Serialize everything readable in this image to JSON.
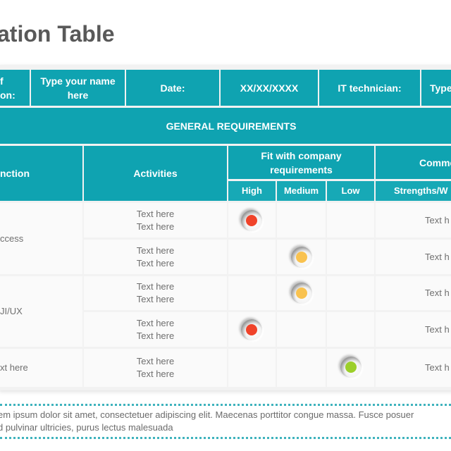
{
  "title": "ation Table",
  "info_row": {
    "name_label": "f\non:",
    "name_label_line1": "f",
    "name_label_line2": "on:",
    "name_value": "Type your name here",
    "date_label": "Date:",
    "date_value": "XX/XX/XXXX",
    "tech_label": "IT technician:",
    "tech_value": "Type"
  },
  "section_header": "GENERAL REQUIREMENTS",
  "columns": {
    "function": "nction",
    "activities": "Activities",
    "fit": "Fit with company requirements",
    "fit_high": "High",
    "fit_medium": "Medium",
    "fit_low": "Low",
    "comments": "Comme",
    "comments_sub": "Strengths/W"
  },
  "rows": [
    {
      "function": "ccess",
      "activities": [
        "Text here",
        "Text here"
      ],
      "fit": "High",
      "comment": "Text h"
    },
    {
      "function": "",
      "activities": [
        "Text here",
        "Text here"
      ],
      "fit": "Medium",
      "comment": "Text h"
    },
    {
      "function": "JI/UX",
      "activities": [
        "Text here",
        "Text here"
      ],
      "fit": "Medium",
      "comment": "Text h"
    },
    {
      "function": "",
      "activities": [
        "Text here",
        "Text here"
      ],
      "fit": "High",
      "comment": "Text h"
    },
    {
      "function": "xt here",
      "activities": [
        "Text here",
        "Text here"
      ],
      "fit": "Low",
      "comment": "Text h"
    }
  ],
  "function_groups": [
    "ccess",
    "JI/UX",
    "xt here"
  ],
  "fit_colors": {
    "High": "#f0432a",
    "Medium": "#f9c24f",
    "Low": "#9ccf2a"
  },
  "footer": {
    "line1": "em ipsum dolor sit amet, consectetuer  adipiscing elit. Maecenas  porttitor congue  massa. Fusce posuer",
    "line2": "d pulvinar ultricies, purus lectus malesuada"
  },
  "accent_color": "#0fa3b1"
}
